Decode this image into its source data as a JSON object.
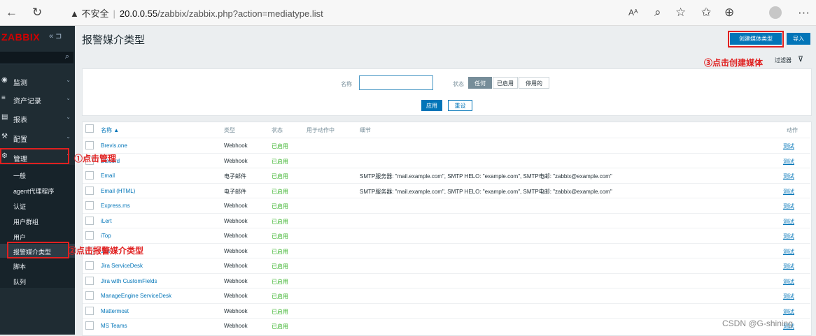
{
  "browser": {
    "back_icon": "arrow-left-icon",
    "reload_icon": "reload-icon",
    "warning": "▲ 不安全",
    "url_host": "20.0.0.55",
    "url_path": "/zabbix/zabbix.php?action=mediatype.list",
    "toolbar_icons": [
      "read-aloud-icon",
      "zoom-icon",
      "add-favorite-icon",
      "favorites-icon",
      "collections-icon",
      "profile-icon",
      "more-icon"
    ]
  },
  "sidebar": {
    "logo": "ZABBIX",
    "collapse": "«",
    "menu": [
      {
        "icon": "eye-icon",
        "label": "监测"
      },
      {
        "icon": "list-icon",
        "label": "资产记录"
      },
      {
        "icon": "chart-icon",
        "label": "报表"
      },
      {
        "icon": "wrench-icon",
        "label": "配置"
      },
      {
        "icon": "gear-icon",
        "label": "管理"
      }
    ],
    "submenu": [
      "一般",
      "agent代理程序",
      "认证",
      "用户群组",
      "用户",
      "报警媒介类型",
      "脚本",
      "队列"
    ]
  },
  "page": {
    "title": "报警媒介类型",
    "create_button": "创建媒体类型",
    "import_button": "导入",
    "filter_tab": "过滤器"
  },
  "filter": {
    "name_label": "名称",
    "name_value": "",
    "status_label": "状态",
    "status_options": [
      "任何",
      "已启用",
      "停用的"
    ],
    "status_selected": "任何",
    "apply": "应用",
    "reset": "重设"
  },
  "table": {
    "headers": {
      "name": "名称 ▲",
      "type": "类型",
      "status": "状态",
      "used_in": "用于动作中",
      "details": "细节",
      "action": "动作"
    },
    "rows": [
      {
        "name": "Brevis.one",
        "type": "Webhook",
        "status": "已启用",
        "details": "",
        "action": "测试"
      },
      {
        "name": "Discord",
        "type": "Webhook",
        "status": "已启用",
        "details": "",
        "action": "测试"
      },
      {
        "name": "Email",
        "type": "电子邮件",
        "status": "已启用",
        "details": "SMTP服务器: \"mail.example.com\", SMTP HELO: \"example.com\", SMTP电邮: \"zabbix@example.com\"",
        "action": "测试"
      },
      {
        "name": "Email (HTML)",
        "type": "电子邮件",
        "status": "已启用",
        "details": "SMTP服务器: \"mail.example.com\", SMTP HELO: \"example.com\", SMTP电邮: \"zabbix@example.com\"",
        "action": "测试"
      },
      {
        "name": "Express.ms",
        "type": "Webhook",
        "status": "已启用",
        "details": "",
        "action": "测试"
      },
      {
        "name": "iLert",
        "type": "Webhook",
        "status": "已启用",
        "details": "",
        "action": "测试"
      },
      {
        "name": "iTop",
        "type": "Webhook",
        "status": "已启用",
        "details": "",
        "action": "测试"
      },
      {
        "name": "Jira",
        "type": "Webhook",
        "status": "已启用",
        "details": "",
        "action": "测试"
      },
      {
        "name": "Jira ServiceDesk",
        "type": "Webhook",
        "status": "已启用",
        "details": "",
        "action": "测试"
      },
      {
        "name": "Jira with CustomFields",
        "type": "Webhook",
        "status": "已启用",
        "details": "",
        "action": "测试"
      },
      {
        "name": "ManageEngine ServiceDesk",
        "type": "Webhook",
        "status": "已启用",
        "details": "",
        "action": "测试"
      },
      {
        "name": "Mattermost",
        "type": "Webhook",
        "status": "已启用",
        "details": "",
        "action": "测试"
      },
      {
        "name": "MS Teams",
        "type": "Webhook",
        "status": "已启用",
        "details": "",
        "action": "测试"
      }
    ]
  },
  "annotations": {
    "step1": "①点击管理",
    "step2": "②点击报警媒介类型",
    "step3": "③点击创建媒体",
    "annotation_color": "#e02020"
  },
  "watermark": "CSDN @G-shining",
  "colors": {
    "sidebar_bg": "#1f2c33",
    "brand_red": "#d40000",
    "primary_blue": "#0275b8",
    "enabled_green": "#3fb532"
  }
}
